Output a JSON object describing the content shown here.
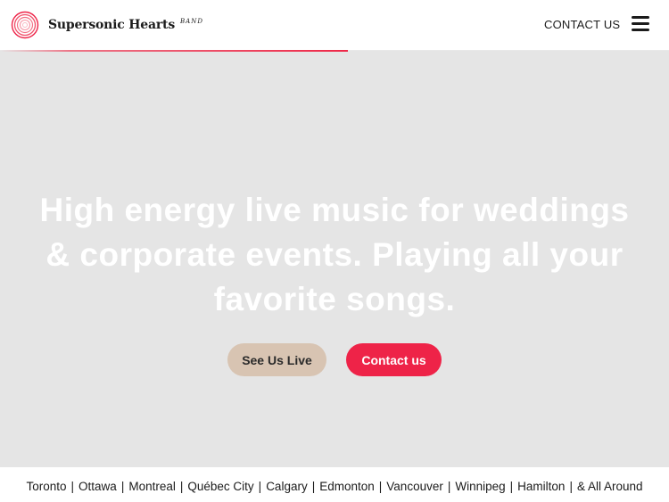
{
  "header": {
    "brand_name": "Supersonic Hearts",
    "brand_sub": "BAND",
    "contact_label": "CONTACT US",
    "menu_icon": "hamburger-icon",
    "logo_icon": "concentric-heart-logo"
  },
  "scroll_progress": 0.52,
  "hero": {
    "headline": "High energy live music for weddings & corporate events. Playing all your favorite songs.",
    "see_live_label": "See Us Live",
    "contact_label": "Contact us"
  },
  "cities": {
    "items": [
      "Toronto",
      "Ottawa",
      "Montreal",
      "Québec City",
      "Calgary",
      "Edmonton",
      "Vancouver",
      "Winnipeg",
      "Hamilton",
      "& All Around"
    ],
    "separator": "|"
  },
  "colors": {
    "accent": "#ee2348",
    "secondary_button": "#d8c4b2",
    "hero_background": "#e5e5e5",
    "text": "#1b1b1b"
  }
}
